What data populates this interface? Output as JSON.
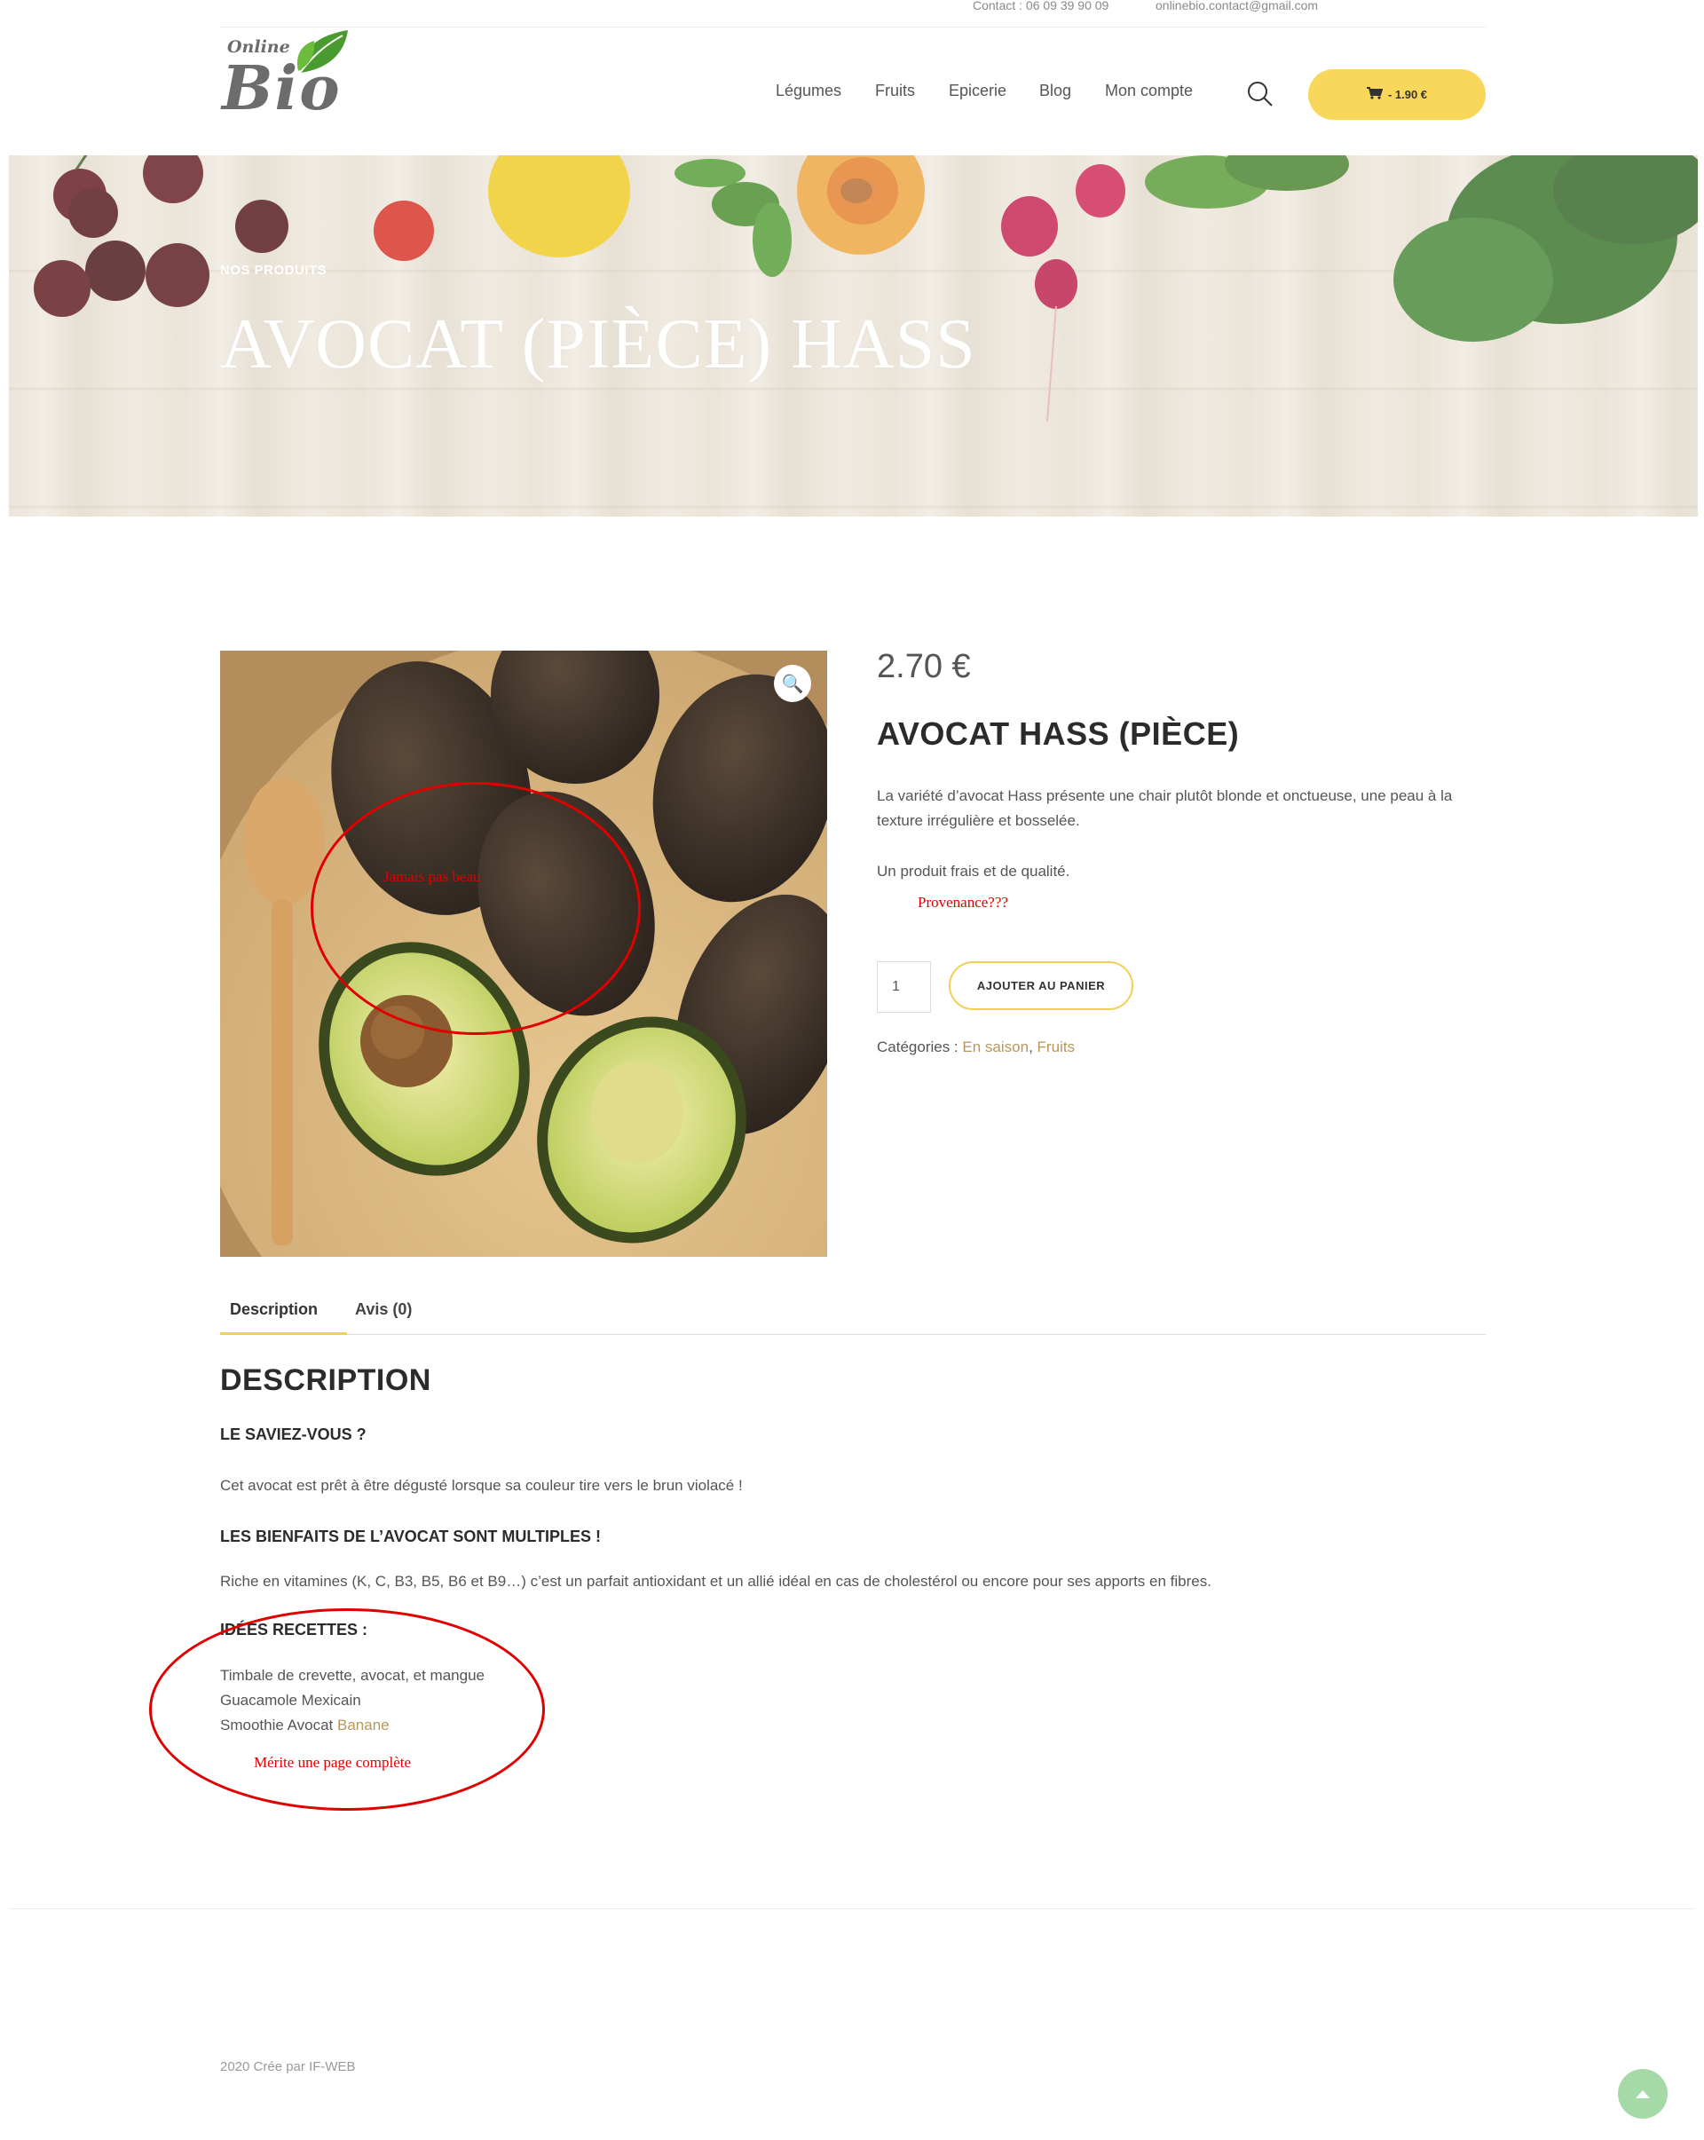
{
  "topbar": {
    "contact": "Contact : 06 09 39 90 09",
    "email": "onlinebio.contact@gmail.com"
  },
  "logo": {
    "online": "Online",
    "bio": "Bio"
  },
  "nav": {
    "items": [
      "Légumes",
      "Fruits",
      "Epicerie",
      "Blog",
      "Mon compte"
    ],
    "search_icon": "search-icon",
    "cart": {
      "icon": "cart-icon",
      "label": "- 1.90 €"
    }
  },
  "hero": {
    "breadcrumb": "NOS PRODUITS",
    "title": "AVOCAT (PIÈCE) HASS"
  },
  "product": {
    "zoom_icon": "🔍",
    "price": "2.70 €",
    "title": "AVOCAT HASS (PIÈCE)",
    "short_description": "La variété d’avocat Hass présente une chair plutôt blonde et onctueuse, une peau à la texture irrégulière et bosselée.",
    "quality": "Un produit frais et de qualité.",
    "quantity": "1",
    "add_to_cart": "AJOUTER AU PANIER",
    "categories_label": "Catégories :",
    "categories": [
      "En saison",
      "Fruits"
    ],
    "categories_sep": ","
  },
  "tabs": [
    "Description",
    "Avis (0)"
  ],
  "description": {
    "heading": "DESCRIPTION",
    "saviez_title": "LE SAVIEZ-VOUS ?",
    "saviez_text": "Cet avocat est prêt à être dégusté lorsque sa couleur tire vers le brun violacé !",
    "bienfaits_title": "LES BIENFAITS DE L’AVOCAT SONT MULTIPLES !",
    "bienfaits_text": "Riche en vitamines (K, C, B3, B5, B6 et B9…) c’est un parfait antioxidant et un allié idéal en cas de cholestérol ou encore pour ses apports en fibres.",
    "recettes_title": "IDÉES RECETTES :",
    "recettes": [
      "Timbale de crevette, avocat, et mangue",
      "Guacamole Mexicain",
      "Smoothie Avocat"
    ],
    "recette_link": "Banane"
  },
  "annotations": {
    "image_note": "Jamais pas beau",
    "provenance_note": "Provenance???",
    "recettes_note": "Mérite une page complète"
  },
  "footer": {
    "copyright": "2020 Crée par IF-WEB",
    "to_top_icon": "arrow-up-icon"
  },
  "colors": {
    "accent_yellow": "#f9d75a",
    "link_gold": "#b8965a",
    "annotation_red": "#e00000",
    "to_top_green": "#a5d9a8"
  }
}
